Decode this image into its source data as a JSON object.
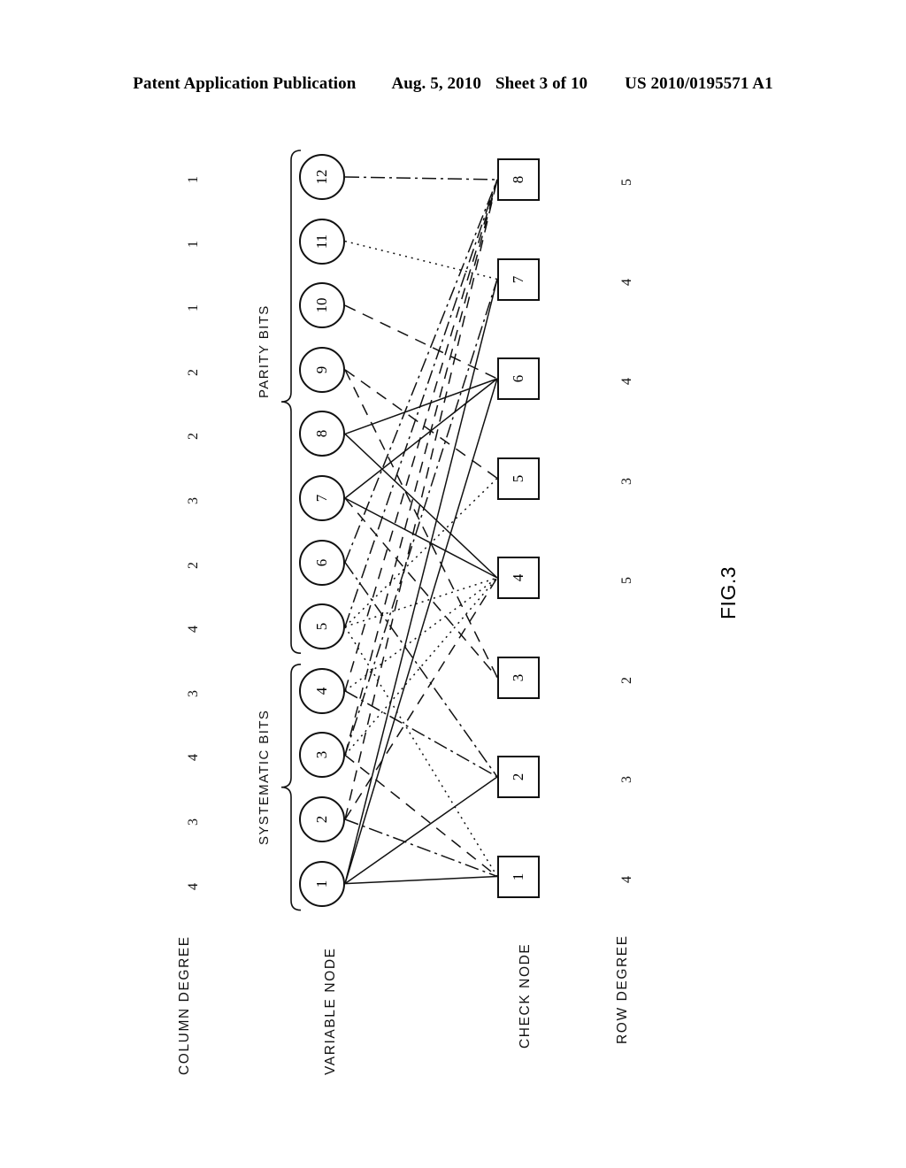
{
  "header": {
    "publication": "Patent Application Publication",
    "date": "Aug. 5, 2010",
    "sheet": "Sheet 3 of 10",
    "patent_number": "US 2010/0195571 A1"
  },
  "figure": {
    "label": "FIG.3",
    "axis_labels": {
      "column_degree": "COLUMN DEGREE",
      "variable_node": "VARIABLE NODE",
      "check_node": "CHECK NODE",
      "row_degree": "ROW DEGREE"
    },
    "group_labels": {
      "parity": "PARITY BITS",
      "systematic": "SYSTEMATIC BITS"
    }
  },
  "chart_data": {
    "type": "diagram",
    "title": "FIG.3",
    "subtype": "tanner-graph-bipartite",
    "orientation": "rotated-90-ccw",
    "variable_nodes": [
      {
        "id": 1,
        "label": "1",
        "column_degree": 4,
        "group": "systematic"
      },
      {
        "id": 2,
        "label": "2",
        "column_degree": 3,
        "group": "systematic"
      },
      {
        "id": 3,
        "label": "3",
        "column_degree": 4,
        "group": "systematic"
      },
      {
        "id": 4,
        "label": "4",
        "column_degree": 3,
        "group": "systematic"
      },
      {
        "id": 5,
        "label": "5",
        "column_degree": 4,
        "group": "parity"
      },
      {
        "id": 6,
        "label": "6",
        "column_degree": 2,
        "group": "parity"
      },
      {
        "id": 7,
        "label": "7",
        "column_degree": 3,
        "group": "parity"
      },
      {
        "id": 8,
        "label": "8",
        "column_degree": 2,
        "group": "parity"
      },
      {
        "id": 9,
        "label": "9",
        "column_degree": 2,
        "group": "parity"
      },
      {
        "id": 10,
        "label": "10",
        "column_degree": 1,
        "group": "parity"
      },
      {
        "id": 11,
        "label": "11",
        "column_degree": 1,
        "group": "parity"
      },
      {
        "id": 12,
        "label": "12",
        "column_degree": 1,
        "group": "parity"
      }
    ],
    "check_nodes": [
      {
        "id": 1,
        "label": "1",
        "row_degree": 4
      },
      {
        "id": 2,
        "label": "2",
        "row_degree": 3
      },
      {
        "id": 3,
        "label": "3",
        "row_degree": 2
      },
      {
        "id": 4,
        "label": "4",
        "row_degree": 5
      },
      {
        "id": 5,
        "label": "5",
        "row_degree": 3
      },
      {
        "id": 6,
        "label": "6",
        "row_degree": 4
      },
      {
        "id": 7,
        "label": "7",
        "row_degree": 4
      },
      {
        "id": 8,
        "label": "8",
        "row_degree": 5
      }
    ],
    "column_degrees": [
      4,
      3,
      4,
      3,
      4,
      2,
      3,
      2,
      2,
      1,
      1,
      1
    ],
    "row_degrees": [
      4,
      3,
      2,
      5,
      3,
      4,
      4,
      5
    ],
    "edges": [
      {
        "v": 1,
        "c": 1,
        "style": "solid"
      },
      {
        "v": 1,
        "c": 2,
        "style": "solid"
      },
      {
        "v": 1,
        "c": 6,
        "style": "solid"
      },
      {
        "v": 1,
        "c": 7,
        "style": "solid"
      },
      {
        "v": 2,
        "c": 1,
        "style": "dashdot"
      },
      {
        "v": 2,
        "c": 4,
        "style": "dashed"
      },
      {
        "v": 2,
        "c": 8,
        "style": "dashed"
      },
      {
        "v": 3,
        "c": 1,
        "style": "dashed"
      },
      {
        "v": 3,
        "c": 4,
        "style": "dotted"
      },
      {
        "v": 3,
        "c": 7,
        "style": "dashdot"
      },
      {
        "v": 3,
        "c": 8,
        "style": "dashed"
      },
      {
        "v": 4,
        "c": 2,
        "style": "dashdot"
      },
      {
        "v": 4,
        "c": 4,
        "style": "dotted"
      },
      {
        "v": 4,
        "c": 8,
        "style": "dashed"
      },
      {
        "v": 5,
        "c": 1,
        "style": "dotted"
      },
      {
        "v": 5,
        "c": 4,
        "style": "dotted"
      },
      {
        "v": 5,
        "c": 5,
        "style": "dotted"
      },
      {
        "v": 5,
        "c": 8,
        "style": "dashdot"
      },
      {
        "v": 6,
        "c": 2,
        "style": "dashdot"
      },
      {
        "v": 6,
        "c": 8,
        "style": "dashdot"
      },
      {
        "v": 7,
        "c": 3,
        "style": "dashed"
      },
      {
        "v": 7,
        "c": 4,
        "style": "solid"
      },
      {
        "v": 7,
        "c": 6,
        "style": "solid"
      },
      {
        "v": 8,
        "c": 4,
        "style": "solid"
      },
      {
        "v": 8,
        "c": 6,
        "style": "solid"
      },
      {
        "v": 9,
        "c": 3,
        "style": "dashed"
      },
      {
        "v": 9,
        "c": 5,
        "style": "dashed"
      },
      {
        "v": 10,
        "c": 6,
        "style": "dashed"
      },
      {
        "v": 11,
        "c": 7,
        "style": "dotted"
      },
      {
        "v": 12,
        "c": 8,
        "style": "dashdot"
      }
    ]
  }
}
